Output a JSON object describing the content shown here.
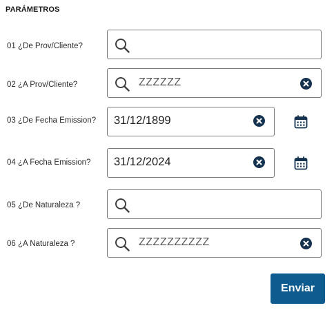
{
  "section": {
    "title": "PARÁMETROS"
  },
  "params": [
    {
      "label": "01 ¿De Prov/Cliente?",
      "value": ""
    },
    {
      "label": "02 ¿A Prov/Cliente?",
      "value": "ZZZZZZ"
    },
    {
      "label": "03 ¿De Fecha Emission?",
      "value": "31/12/1899"
    },
    {
      "label": "04 ¿A Fecha Emission?",
      "value": "31/12/2024"
    },
    {
      "label": "05 ¿De Naturaleza ?",
      "value": ""
    },
    {
      "label": "06 ¿A Naturaleza ?",
      "value": "ZZZZZZZZZZ"
    }
  ],
  "actions": {
    "send_label": "Enviar"
  },
  "icons": {
    "search": "search-icon",
    "clear": "clear-icon",
    "calendar": "calendar-icon"
  },
  "colors": {
    "primary": "#0d5b8f",
    "clear_icon": "#15334f",
    "icon": "#404040",
    "border": "#7a7a7a"
  }
}
